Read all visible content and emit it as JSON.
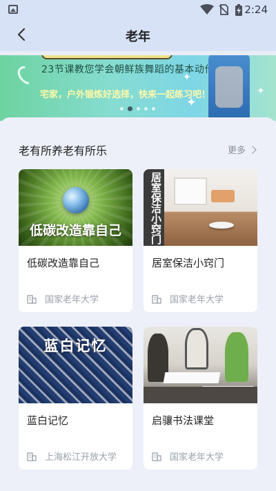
{
  "status_bar": {
    "time": "2:24"
  },
  "header": {
    "title": "老年"
  },
  "banner": {
    "line1": "23节课教您学会朝鲜族舞蹈的基本动作",
    "line2": "宅家，户外锻炼好选择，快来一起练习吧！",
    "active_slide": 2,
    "slide_count": 5
  },
  "section": {
    "title": "老有所养老有所乐",
    "more_label": "更多"
  },
  "cards": [
    {
      "thumb_caption": "低碳改造靠自己",
      "name": "低碳改造靠自己",
      "org": "国家老年大学"
    },
    {
      "thumb_caption": "居室保洁小窍门",
      "name": "居室保洁小窍门",
      "org": "国家老年大学"
    },
    {
      "thumb_caption": "蓝白记忆",
      "name": "蓝白记忆",
      "org": "上海松江开放大学"
    },
    {
      "name": "启骧书法课堂",
      "org": "国家老年大学"
    }
  ],
  "icons": {
    "status": [
      "image-icon",
      "wifi-icon",
      "no-sim-icon",
      "battery-charging-icon"
    ],
    "back": "back-arrow-icon",
    "more": "chevron-right-icon",
    "org": "building-icon"
  }
}
